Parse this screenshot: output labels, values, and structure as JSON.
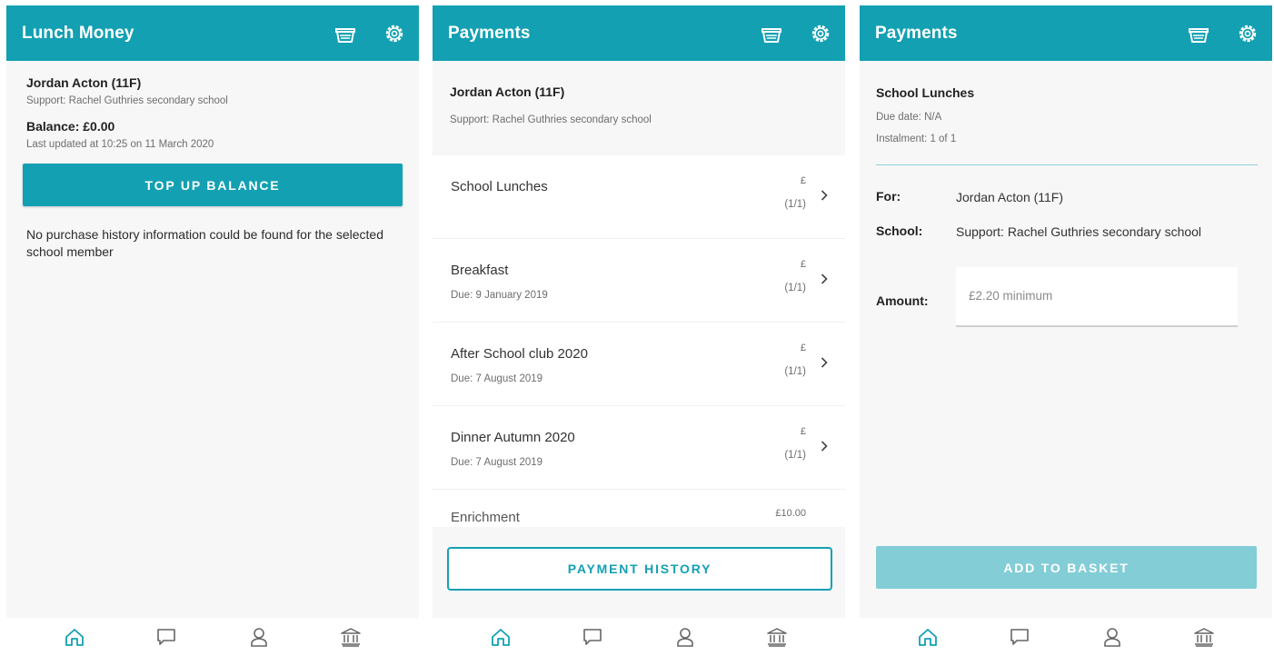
{
  "colors": {
    "brand": "#13a0b2",
    "brand_disabled": "#83cdd7",
    "background": "#f7f7f8"
  },
  "icons": {
    "basket": "basket-icon",
    "settings": "gear-icon",
    "home": "home-icon",
    "messages": "chat-icon",
    "profile": "person-icon",
    "bank": "bank-icon",
    "chevron": "chevron-right-icon"
  },
  "screen1": {
    "title": "Lunch Money",
    "student_name": "Jordan Acton (11F)",
    "school": "Support: Rachel Guthries secondary school",
    "balance": "Balance: £0.00",
    "last_updated": "Last updated at 10:25 on 11 March 2020",
    "topup_label": "TOP UP BALANCE",
    "no_history": "No purchase history information could be found for the selected school member"
  },
  "screen2": {
    "title": "Payments",
    "student_name": "Jordan Acton (11F)",
    "school": "Support: Rachel Guthries secondary school",
    "items": [
      {
        "title": "School Lunches",
        "due": "",
        "currency": "£",
        "instalment": "(1/1)"
      },
      {
        "title": "Breakfast",
        "due": "Due: 9 January 2019",
        "currency": "£",
        "instalment": "(1/1)"
      },
      {
        "title": "After School club 2020",
        "due": "Due: 7 August 2019",
        "currency": "£",
        "instalment": "(1/1)"
      },
      {
        "title": "Dinner Autumn 2020",
        "due": "Due: 7 August 2019",
        "currency": "£",
        "instalment": "(1/1)"
      },
      {
        "title": "Enrichment",
        "due": "",
        "currency": "£10.00",
        "instalment": ""
      }
    ],
    "history_label": "PAYMENT HISTORY"
  },
  "screen3": {
    "title": "Payments",
    "item_title": "School Lunches",
    "due_date": "Due date:  N/A",
    "instalment": "Instalment:  1 of 1",
    "for_label": "For:",
    "for_value": "Jordan Acton (11F)",
    "school_label": "School:",
    "school_value": "Support: Rachel Guthries secondary school",
    "amount_label": "Amount:",
    "amount_placeholder": "£2.20 minimum",
    "basket_label": "ADD TO BASKET"
  }
}
